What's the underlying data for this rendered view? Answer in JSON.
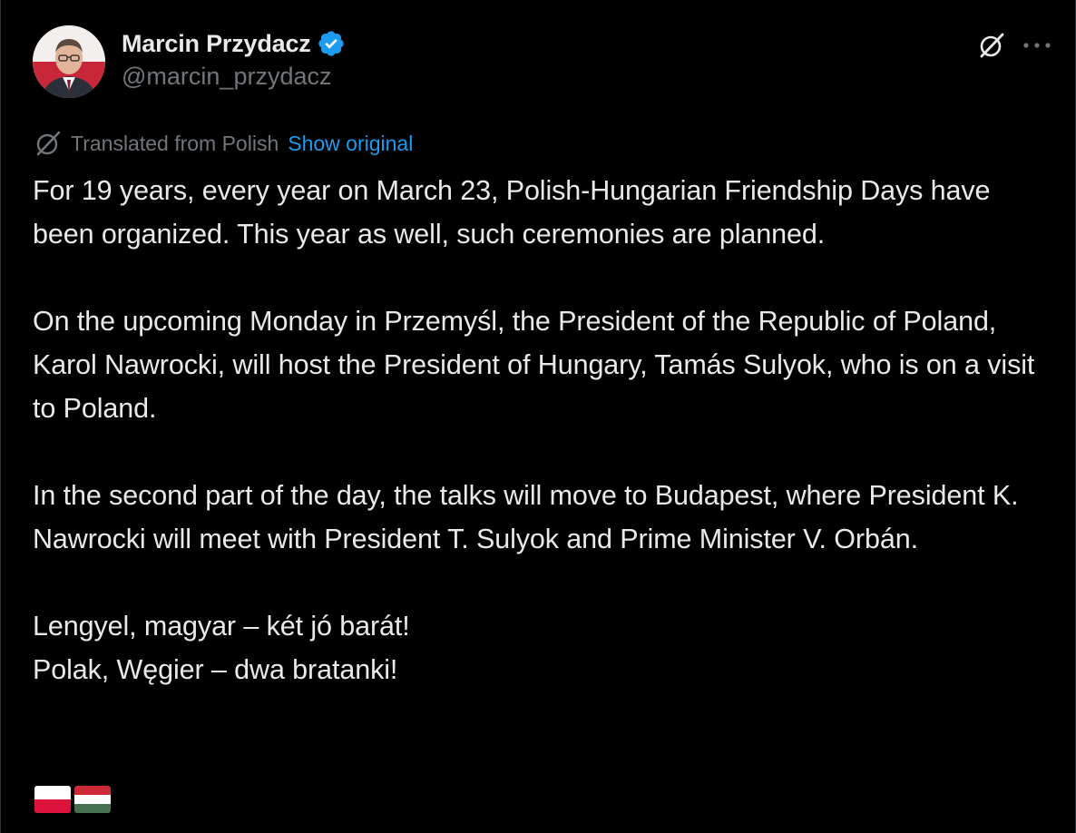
{
  "author": {
    "display_name": "Marcin Przydacz",
    "handle": "@marcin_przydacz",
    "verified_icon": "verified-badge-icon"
  },
  "actions": {
    "grok_icon": "grok-icon",
    "more_icon": "more-options-icon"
  },
  "translation": {
    "label": "Translated from Polish",
    "show_original": "Show original"
  },
  "body": {
    "p1": "For 19 years, every year on March 23, Polish-Hungarian Friendship Days have been organized. This year as well, such ceremonies are planned.",
    "p2": "On the upcoming Monday in Przemyśl, the President of the Republic of Poland, Karol Nawrocki, will host the President of Hungary, Tamás Sulyok, who is on a visit to Poland.",
    "p3": "In the second part of the day, the talks will move to Budapest, where President K. Nawrocki will meet with President T. Sulyok and Prime Minister V. Orbán.",
    "p4": "Lengyel, magyar – két jó barát!\nPolak, Węgier – dwa bratanki!"
  },
  "flags": [
    {
      "name": "poland-flag-emoji",
      "stripes": [
        "#ffffff",
        "#dc143c"
      ]
    },
    {
      "name": "hungary-flag-emoji",
      "stripes": [
        "#ce2939",
        "#ffffff",
        "#477050"
      ]
    }
  ],
  "colors": {
    "background": "#000000",
    "text": "#e7e9ea",
    "secondary": "#71767b",
    "link": "#1d9bf0",
    "verified": "#1d9bf0"
  }
}
